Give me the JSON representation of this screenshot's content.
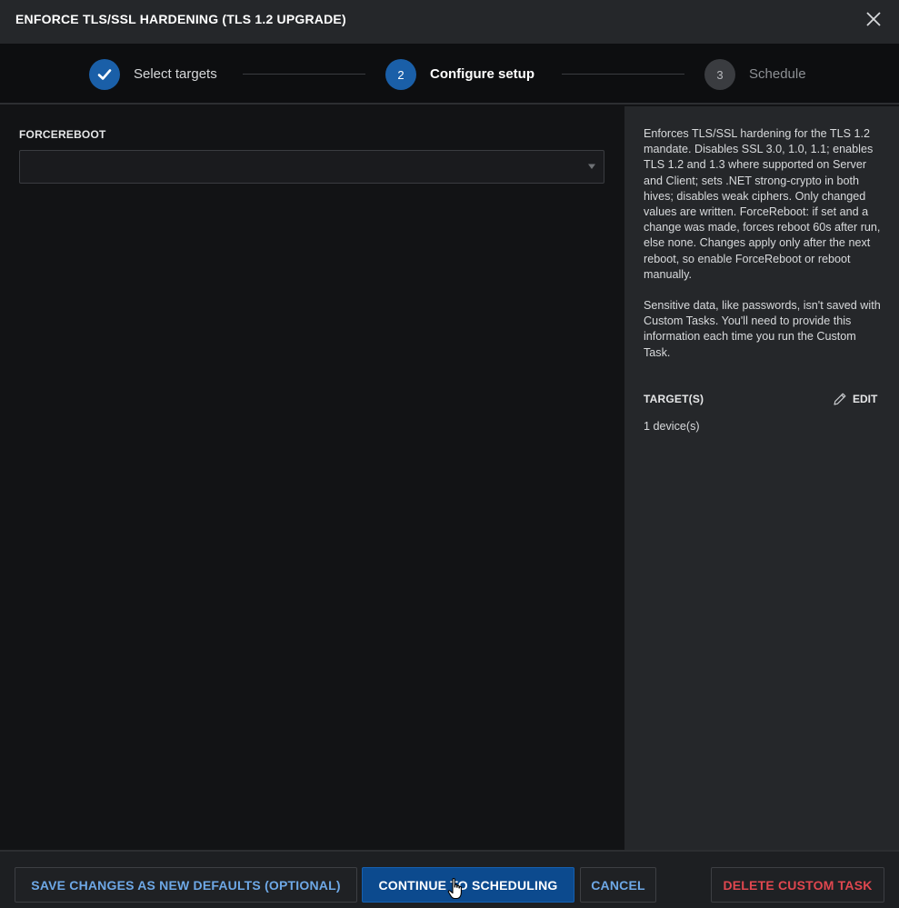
{
  "header": {
    "title": "ENFORCE TLS/SSL HARDENING (TLS 1.2 UPGRADE)"
  },
  "stepper": {
    "steps": [
      {
        "number": "1",
        "label": "Select targets",
        "state": "complete"
      },
      {
        "number": "2",
        "label": "Configure setup",
        "state": "active"
      },
      {
        "number": "3",
        "label": "Schedule",
        "state": "pending"
      }
    ]
  },
  "form": {
    "forcereboot_label": "FORCEREBOOT",
    "forcereboot_value": ""
  },
  "sidebar": {
    "description_1": "Enforces TLS/SSL hardening for the TLS 1.2 mandate. Disables SSL 3.0, 1.0, 1.1; enables TLS 1.2 and 1.3 where supported on Server and Client; sets .NET strong-crypto in both hives; disables weak ciphers. Only changed values are written. ForceReboot: if set and a change was made, forces reboot 60s after run, else none. Changes apply only after the next reboot, so enable ForceReboot or reboot manually.",
    "description_2": "Sensitive data, like passwords, isn't saved with Custom Tasks. You'll need to provide this information each time you run the Custom Task.",
    "targets_label": "TARGET(S)",
    "edit_label": "EDIT",
    "target_count": "1 device(s)"
  },
  "footer": {
    "save_defaults_label": "SAVE CHANGES AS NEW DEFAULTS (OPTIONAL)",
    "continue_label": "CONTINUE TO SCHEDULING",
    "cancel_label": "CANCEL",
    "delete_label": "DELETE CUSTOM TASK"
  },
  "colors": {
    "accent": "#0c4a8e",
    "link": "#6ea8e6",
    "danger": "#e0474f",
    "step_complete": "#1a5fa8",
    "step_pending": "#3a3c40"
  },
  "icons": {
    "close": "close-icon",
    "check": "check-icon",
    "caret": "chevron-down-icon",
    "edit": "pencil-icon",
    "cursor": "hand-pointer-icon"
  }
}
